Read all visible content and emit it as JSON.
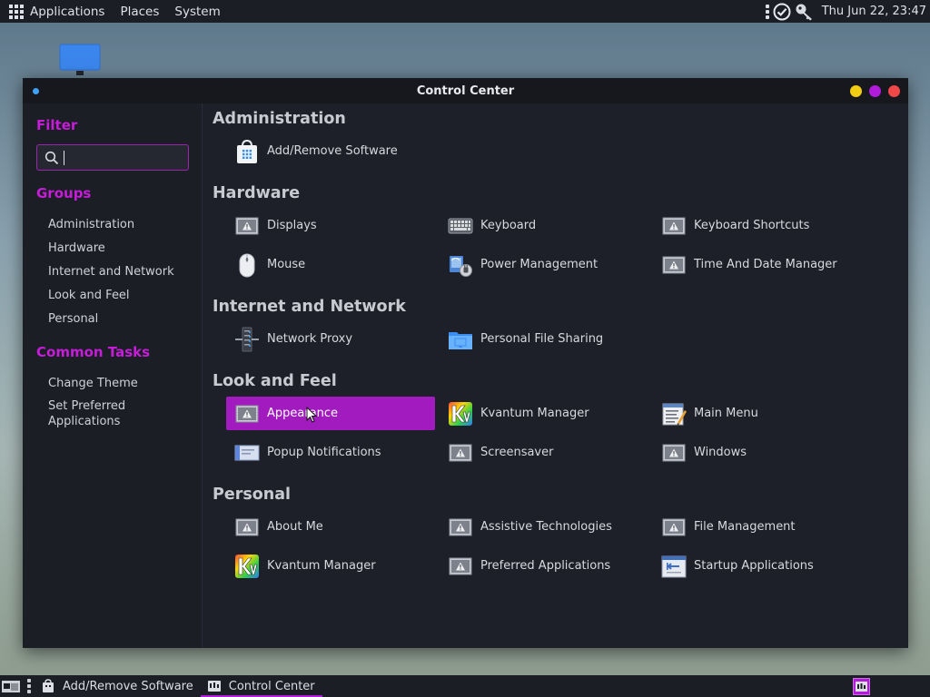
{
  "top_panel": {
    "menus": [
      "Applications",
      "Places",
      "System"
    ],
    "clock": "Thu Jun 22, 23:47"
  },
  "window": {
    "title": "Control Center",
    "buttons": {
      "minimize_color": "#f0cc12",
      "maximize_color": "#b01cd9",
      "close_color": "#f04848"
    }
  },
  "sidebar": {
    "filter_label": "Filter",
    "search": {
      "value": "",
      "placeholder": ""
    },
    "groups_label": "Groups",
    "groups": [
      "Administration",
      "Hardware",
      "Internet and Network",
      "Look and Feel",
      "Personal"
    ],
    "tasks_label": "Common Tasks",
    "tasks": [
      "Change Theme",
      "Set Preferred Applications"
    ]
  },
  "sections": [
    {
      "title": "Administration",
      "items": [
        {
          "label": "Add/Remove Software",
          "icon": "software-store-icon"
        }
      ]
    },
    {
      "title": "Hardware",
      "items": [
        {
          "label": "Displays",
          "icon": "missing-image-icon"
        },
        {
          "label": "Keyboard",
          "icon": "keyboard-icon"
        },
        {
          "label": "Keyboard Shortcuts",
          "icon": "missing-image-icon"
        },
        {
          "label": "Mouse",
          "icon": "mouse-icon"
        },
        {
          "label": "Power Management",
          "icon": "power-management-icon"
        },
        {
          "label": "Time And Date Manager",
          "icon": "missing-image-icon"
        }
      ]
    },
    {
      "title": "Internet and Network",
      "items": [
        {
          "label": "Network Proxy",
          "icon": "network-proxy-icon"
        },
        {
          "label": "Personal File Sharing",
          "icon": "folder-share-icon"
        }
      ]
    },
    {
      "title": "Look and Feel",
      "items": [
        {
          "label": "Appearance",
          "icon": "missing-image-icon",
          "selected": true
        },
        {
          "label": "Kvantum Manager",
          "icon": "kvantum-icon"
        },
        {
          "label": "Main Menu",
          "icon": "main-menu-icon"
        },
        {
          "label": "Popup Notifications",
          "icon": "notification-icon"
        },
        {
          "label": "Screensaver",
          "icon": "missing-image-icon"
        },
        {
          "label": "Windows",
          "icon": "missing-image-icon"
        }
      ]
    },
    {
      "title": "Personal",
      "items": [
        {
          "label": "About Me",
          "icon": "missing-image-icon"
        },
        {
          "label": "Assistive Technologies",
          "icon": "missing-image-icon"
        },
        {
          "label": "File Management",
          "icon": "missing-image-icon"
        },
        {
          "label": "Kvantum Manager",
          "icon": "kvantum-icon"
        },
        {
          "label": "Preferred Applications",
          "icon": "missing-image-icon"
        },
        {
          "label": "Startup Applications",
          "icon": "startup-apps-icon"
        }
      ]
    }
  ],
  "taskbar": {
    "tasks": [
      {
        "label": "Add/Remove Software",
        "active": false
      },
      {
        "label": "Control Center",
        "active": true
      }
    ]
  },
  "colors": {
    "accent": "#a21bbf",
    "heading_accent": "#c51dd8",
    "window_bg": "#1e2029",
    "panel_bg": "#1c1e26"
  }
}
